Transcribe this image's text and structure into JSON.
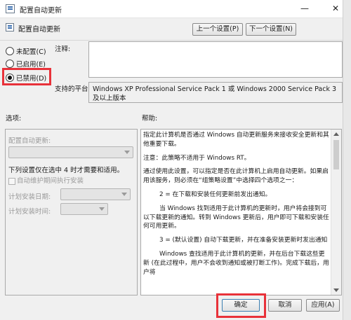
{
  "window": {
    "title": "配置自动更新",
    "header_title": "配置自动更新",
    "minimize_glyph": "—",
    "close_glyph": "✕"
  },
  "nav": {
    "prev_setting": "上一个设置(P)",
    "next_setting": "下一个设置(N)"
  },
  "state_options": [
    {
      "label": "未配置(C)",
      "selected": false
    },
    {
      "label": "已启用(E)",
      "selected": false
    },
    {
      "label": "已禁用(D)",
      "selected": true
    }
  ],
  "comment": {
    "label": "注释:",
    "value": ""
  },
  "platform": {
    "label": "支持的平台:",
    "value": "Windows XP Professional Service Pack 1 或 Windows 2000 Service Pack 3 及以上版本"
  },
  "options": {
    "label": "选项:",
    "configure_label": "配置自动更新:",
    "note": "下列设置仅在选中 4 时才需要和适用。",
    "maintenance_checkbox": "自动维护期间执行安装",
    "install_day_label": "计划安装日期:",
    "install_time_label": "计划安装时间:"
  },
  "help": {
    "label": "帮助:",
    "paragraphs": [
      "指定此计算机是否通过 Windows 自动更新服务来接收安全更新和其他重要下载。",
      "注意：此策略不适用于 Windows RT。",
      "通过使用此设置，可以指定是否在此计算机上启用自动更新。如果启用该服务，则必须在“组策略设置”中选择四个选项之一：",
      "2 = 在下载和安装任何更新前发出通知。",
      "当 Windows 找到适用于此计算机的更新时，用户将会接到可以下载更新的通知。转到 Windows 更新后，用户即可下载和安装任何可用更新。",
      "3 = (默认设置) 自动下载更新，并在准备安装更新时发出通知",
      "Windows 查找适用于此计算机的更新，并在后台下载这些更新 (在此过程中，用户不会收到通知或被打断工作)。完成下载后，用户将"
    ]
  },
  "footer": {
    "ok": "确定",
    "cancel": "取消",
    "apply": "应用(A)"
  },
  "colors": {
    "highlight_box": "#e8323a",
    "dialog_background": "#f0f0f0"
  }
}
